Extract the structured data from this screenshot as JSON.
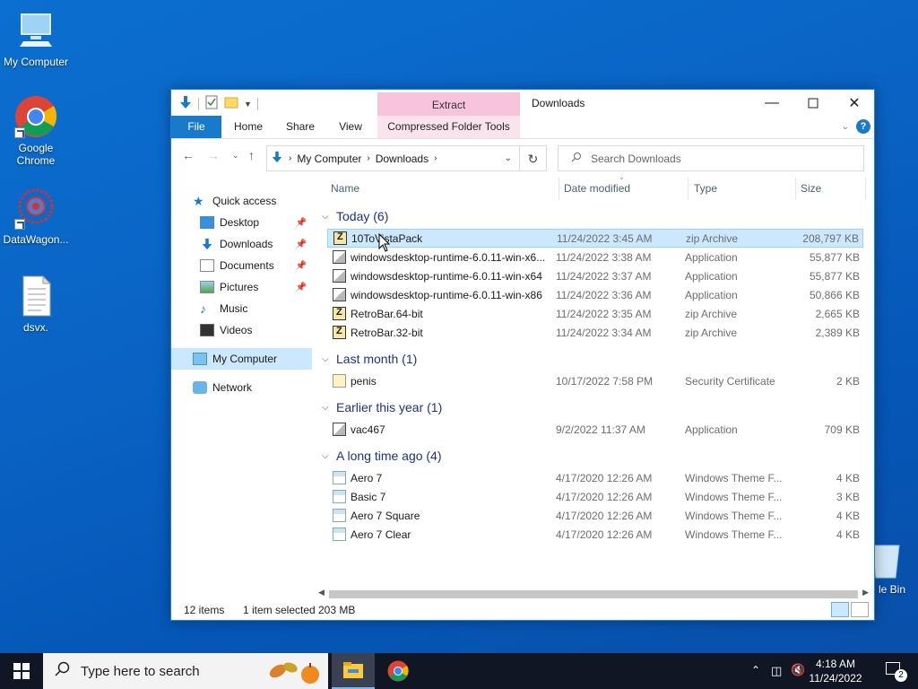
{
  "desktop": {
    "icons": [
      {
        "label": "My Computer"
      },
      {
        "label": "Google Chrome"
      },
      {
        "label": "DataWagon..."
      },
      {
        "label": "dsvx."
      },
      {
        "label": "le Bin"
      }
    ]
  },
  "window": {
    "title": "Downloads",
    "extract_tab": "Extract",
    "tabs": {
      "file": "File",
      "home": "Home",
      "share": "Share",
      "view": "View",
      "cft": "Compressed Folder Tools"
    },
    "address": {
      "seg1": "My Computer",
      "seg2": "Downloads"
    },
    "search_placeholder": "Search Downloads",
    "nav": {
      "quick_access": "Quick access",
      "desktop": "Desktop",
      "downloads": "Downloads",
      "documents": "Documents",
      "pictures": "Pictures",
      "music": "Music",
      "videos": "Videos",
      "my_computer": "My Computer",
      "network": "Network"
    },
    "columns": {
      "name": "Name",
      "date": "Date modified",
      "type": "Type",
      "size": "Size"
    },
    "groups": [
      {
        "label": "Today (6)",
        "rows": [
          {
            "name": "10ToVistaPack",
            "date": "11/24/2022 3:45 AM",
            "type": "zip Archive",
            "size": "208,797 KB",
            "icon": "zip"
          },
          {
            "name": "windowsdesktop-runtime-6.0.11-win-x6...",
            "date": "11/24/2022 3:38 AM",
            "type": "Application",
            "size": "55,877 KB",
            "icon": "app"
          },
          {
            "name": "windowsdesktop-runtime-6.0.11-win-x64",
            "date": "11/24/2022 3:37 AM",
            "type": "Application",
            "size": "55,877 KB",
            "icon": "app"
          },
          {
            "name": "windowsdesktop-runtime-6.0.11-win-x86",
            "date": "11/24/2022 3:36 AM",
            "type": "Application",
            "size": "50,866 KB",
            "icon": "app"
          },
          {
            "name": "RetroBar.64-bit",
            "date": "11/24/2022 3:35 AM",
            "type": "zip Archive",
            "size": "2,665 KB",
            "icon": "zip"
          },
          {
            "name": "RetroBar.32-bit",
            "date": "11/24/2022 3:34 AM",
            "type": "zip Archive",
            "size": "2,389 KB",
            "icon": "zip"
          }
        ]
      },
      {
        "label": "Last month (1)",
        "rows": [
          {
            "name": "penis",
            "date": "10/17/2022 7:58 PM",
            "type": "Security Certificate",
            "size": "2 KB",
            "icon": "cert"
          }
        ]
      },
      {
        "label": "Earlier this year (1)",
        "rows": [
          {
            "name": "vac467",
            "date": "9/2/2022 11:37 AM",
            "type": "Application",
            "size": "709 KB",
            "icon": "app"
          }
        ]
      },
      {
        "label": "A long time ago (4)",
        "rows": [
          {
            "name": "Aero 7",
            "date": "4/17/2020 12:26 AM",
            "type": "Windows Theme F...",
            "size": "4 KB",
            "icon": "theme"
          },
          {
            "name": "Basic 7",
            "date": "4/17/2020 12:26 AM",
            "type": "Windows Theme F...",
            "size": "3 KB",
            "icon": "theme"
          },
          {
            "name": "Aero 7 Square",
            "date": "4/17/2020 12:26 AM",
            "type": "Windows Theme F...",
            "size": "4 KB",
            "icon": "theme"
          },
          {
            "name": "Aero 7 Clear",
            "date": "4/17/2020 12:26 AM",
            "type": "Windows Theme F...",
            "size": "4 KB",
            "icon": "theme"
          }
        ]
      }
    ],
    "status": {
      "count": "12 items",
      "selected": "1 item selected",
      "size": "203 MB"
    }
  },
  "taskbar": {
    "search_placeholder": "Type here to search",
    "time": "4:18 AM",
    "date": "11/24/2022",
    "notifications": "2"
  }
}
